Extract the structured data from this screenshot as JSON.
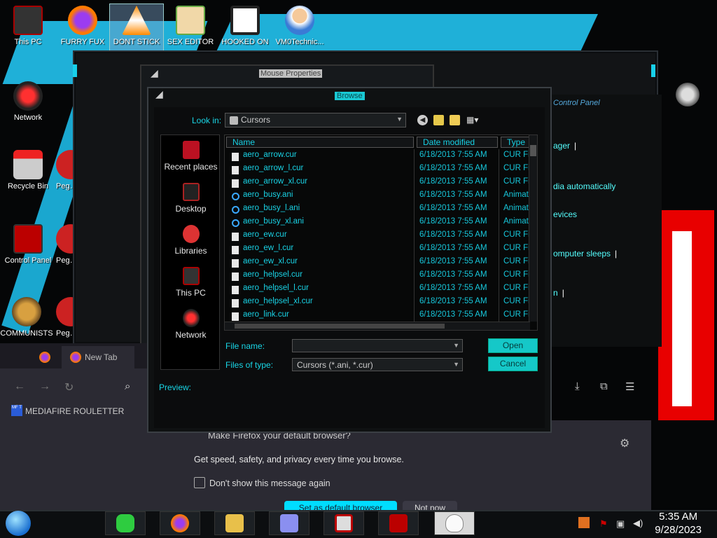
{
  "desktop": {
    "icons": [
      {
        "label": "This PC"
      },
      {
        "label": "FURRY FUX"
      },
      {
        "label": "DONT STICK"
      },
      {
        "label": "SEX EDITOR"
      },
      {
        "label": "HOOKED ON"
      },
      {
        "label": "VM0Technic..."
      },
      {
        "label": "Network"
      },
      {
        "label": "Recycle Bin"
      },
      {
        "label": "Control Panel"
      },
      {
        "label": "COMMUNISTS"
      },
      {
        "label": "Peggle"
      },
      {
        "label": "Peggle"
      },
      {
        "label": "Peggle"
      }
    ]
  },
  "mouse_window": {
    "title": "Mouse Properties"
  },
  "browse": {
    "title": "Browse",
    "look_in_label": "Look in:",
    "look_in_value": "Cursors",
    "places": [
      "Recent places",
      "Desktop",
      "Libraries",
      "This PC",
      "Network"
    ],
    "columns": {
      "name": "Name",
      "date": "Date modified",
      "type": "Type"
    },
    "files": [
      {
        "name": "aero_arrow.cur",
        "date": "6/18/2013 7:55 AM",
        "type": "CUR File",
        "kind": "cur"
      },
      {
        "name": "aero_arrow_l.cur",
        "date": "6/18/2013 7:55 AM",
        "type": "CUR File",
        "kind": "cur"
      },
      {
        "name": "aero_arrow_xl.cur",
        "date": "6/18/2013 7:55 AM",
        "type": "CUR File",
        "kind": "cur"
      },
      {
        "name": "aero_busy.ani",
        "date": "6/18/2013 7:55 AM",
        "type": "Animated",
        "kind": "ani"
      },
      {
        "name": "aero_busy_l.ani",
        "date": "6/18/2013 7:55 AM",
        "type": "Animated",
        "kind": "ani"
      },
      {
        "name": "aero_busy_xl.ani",
        "date": "6/18/2013 7:55 AM",
        "type": "Animated",
        "kind": "ani"
      },
      {
        "name": "aero_ew.cur",
        "date": "6/18/2013 7:55 AM",
        "type": "CUR File",
        "kind": "cur"
      },
      {
        "name": "aero_ew_l.cur",
        "date": "6/18/2013 7:55 AM",
        "type": "CUR File",
        "kind": "cur"
      },
      {
        "name": "aero_ew_xl.cur",
        "date": "6/18/2013 7:55 AM",
        "type": "CUR File",
        "kind": "cur"
      },
      {
        "name": "aero_helpsel.cur",
        "date": "6/18/2013 7:55 AM",
        "type": "CUR File",
        "kind": "cur"
      },
      {
        "name": "aero_helpsel_l.cur",
        "date": "6/18/2013 7:55 AM",
        "type": "CUR File",
        "kind": "cur"
      },
      {
        "name": "aero_helpsel_xl.cur",
        "date": "6/18/2013 7:55 AM",
        "type": "CUR File",
        "kind": "cur"
      },
      {
        "name": "aero_link.cur",
        "date": "6/18/2013 7:55 AM",
        "type": "CUR File",
        "kind": "cur"
      }
    ],
    "file_name_label": "File name:",
    "file_name_value": "",
    "file_type_label": "Files of type:",
    "file_type_value": "Cursors (*.ani, *.cur)",
    "open_label": "Open",
    "cancel_label": "Cancel",
    "preview_label": "Preview:"
  },
  "control_panel": {
    "title": "Control Panel",
    "items": [
      "ager",
      "dia automatically",
      "evices",
      "omputer sleeps",
      "n"
    ]
  },
  "firefox": {
    "tab_label": "New Tab",
    "bookmark": "MEDIAFIRE ROULETTER",
    "bookmark_badge": "MF T",
    "promo_title": "Make Firefox your default browser?",
    "promo_text": "Get speed, safety, and privacy every time you browse.",
    "checkbox_label": "Don't show this message again",
    "set_default_label": "Set as default browser",
    "not_now_label": "Not now"
  },
  "taskbar": {
    "time": "5:35 AM",
    "date": "9/28/2023"
  },
  "colors": {
    "accent": "#19d6e6",
    "button": "#15c8c8"
  }
}
